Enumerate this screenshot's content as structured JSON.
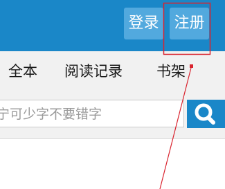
{
  "header": {
    "login_label": "登录",
    "register_label": "注册",
    "bg_color": "#1a87c8",
    "button_color": "#52a9de"
  },
  "nav": {
    "items": [
      {
        "label": "全本"
      },
      {
        "label": "阅读记录"
      },
      {
        "label": "书架"
      }
    ]
  },
  "search": {
    "placeholder": "宁可少字不要错字",
    "button_icon": "search-icon"
  },
  "annotation": {
    "color": "#d9232e"
  }
}
